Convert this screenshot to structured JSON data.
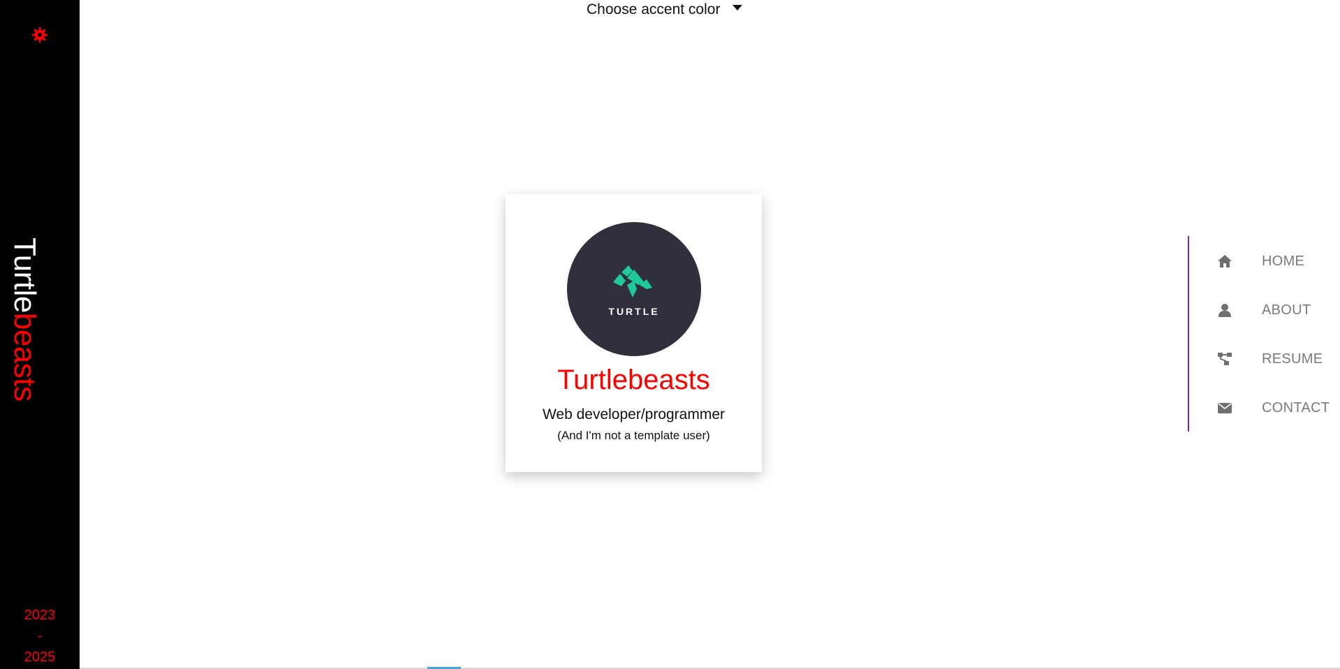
{
  "sidebar": {
    "brand_part_1": "Turtle",
    "brand_part_2": "beasts",
    "year_start": "2023",
    "year_sep": "-",
    "year_end": "2025",
    "gear_icon": "gear-icon"
  },
  "accent_picker": {
    "label": "Choose accent color"
  },
  "card": {
    "logo_text": "TURTLE",
    "title": "Turtlebeasts",
    "subtitle": "Web developer/programmer",
    "tagline": "(And I'm not a template user)"
  },
  "nav": {
    "items": [
      {
        "label": "HOME",
        "icon": "home-icon"
      },
      {
        "label": "ABOUT",
        "icon": "user-icon"
      },
      {
        "label": "RESUME",
        "icon": "sitemap-icon"
      },
      {
        "label": "CONTACT",
        "icon": "envelope-icon"
      }
    ]
  },
  "colors": {
    "accent": "#ff0000",
    "sidebar_bg": "#000000",
    "nav_border": "#7b1fd8",
    "nav_text": "#7a7a7a",
    "avatar_bg": "#302f3d",
    "logo_green": "#1fc99a"
  }
}
